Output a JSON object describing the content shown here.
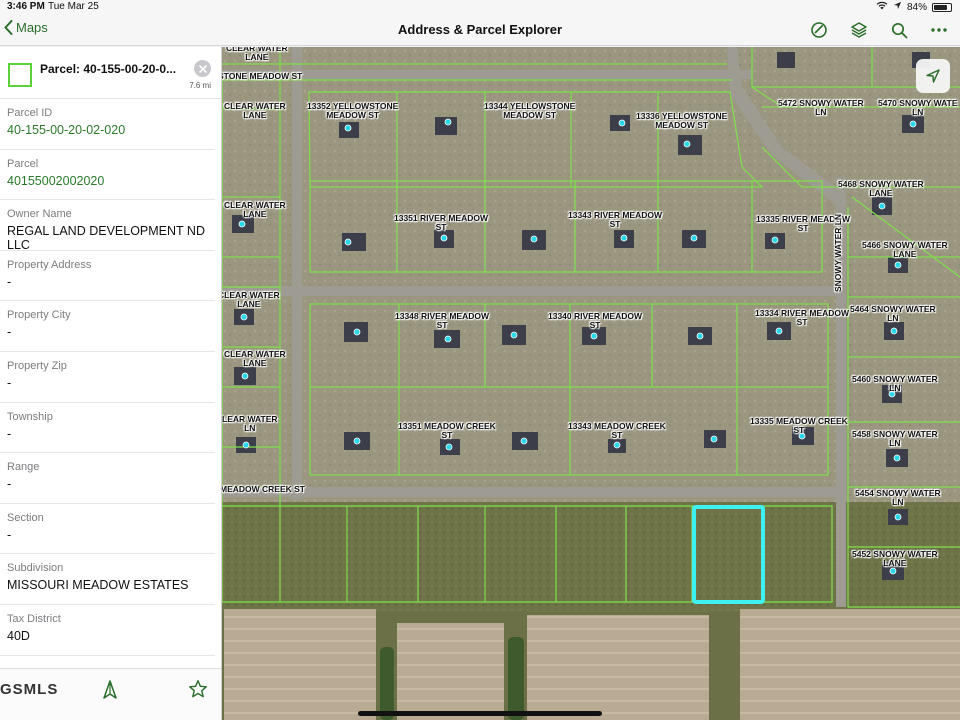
{
  "status": {
    "time": "3:46 PM",
    "date": "Tue Mar 25",
    "battery": "84%",
    "battery_level": 0.84
  },
  "nav": {
    "back_label": "Maps",
    "title": "Address & Parcel Explorer",
    "actions": [
      "measure-icon",
      "layers-icon",
      "search-icon",
      "more-icon"
    ]
  },
  "parcel": {
    "title": "Parcel: 40-155-00-20-0...",
    "distance": "7.6 mi",
    "fields": [
      {
        "label": "Parcel ID",
        "value": "40-155-00-20-02-020",
        "link": true
      },
      {
        "label": "Parcel",
        "value": "40155002002020",
        "link": true
      },
      {
        "label": "Owner Name",
        "value": "REGAL LAND DEVELOPMENT ND LLC",
        "link": false
      },
      {
        "label": "Property Address",
        "value": "-",
        "link": false
      },
      {
        "label": "Property City",
        "value": "-",
        "link": false
      },
      {
        "label": "Property Zip",
        "value": "-",
        "link": false
      },
      {
        "label": "Township",
        "value": "-",
        "link": false
      },
      {
        "label": "Range",
        "value": "-",
        "link": false
      },
      {
        "label": "Section",
        "value": "-",
        "link": false
      },
      {
        "label": "Subdivision",
        "value": "MISSOURI MEADOW ESTATES",
        "link": false
      },
      {
        "label": "Tax District",
        "value": "40D",
        "link": false
      }
    ]
  },
  "tabbar": {
    "logo": "GSMLS",
    "icons": [
      "compass-icon",
      "star-icon"
    ]
  },
  "map": {
    "labels": [
      {
        "text": "CLEAR WATER\nLANE"
      },
      {
        "text": "STONE MEADOW ST"
      },
      {
        "text": "CLEAR WATER\nLANE"
      },
      {
        "text": "13352 YELLOWSTONE\nMEADOW ST"
      },
      {
        "text": "13344 YELLOWSTONE\nMEADOW ST"
      },
      {
        "text": "13336 YELLOWSTONE\nMEADOW ST"
      },
      {
        "text": "5472 SNOWY WATER\nLN"
      },
      {
        "text": "5470 SNOWY WATE\nLN"
      },
      {
        "text": "5468 SNOWY WATER\nLANE"
      },
      {
        "text": "CLEAR WATER\nLANE"
      },
      {
        "text": "13351 RIVER MEADOW\nST"
      },
      {
        "text": "13343 RIVER MEADOW\nST"
      },
      {
        "text": "13335 RIVER MEADOW\nST"
      },
      {
        "text": "SNOWY WATER LN"
      },
      {
        "text": "5466 SNOWY WATER\nLANE"
      },
      {
        "text": "CLEAR WATER\nLANE"
      },
      {
        "text": "13348 RIVER MEADOW\nST"
      },
      {
        "text": "13340 RIVER MEADOW\nST"
      },
      {
        "text": "13334 RIVER MEADOW\nST"
      },
      {
        "text": "5464 SNOWY WATER\nLN"
      },
      {
        "text": "CLEAR WATER\nLANE"
      },
      {
        "text": "5460 SNOWY WATER\nLN"
      },
      {
        "text": "LEAR WATER\nLN"
      },
      {
        "text": "13351 MEADOW CREEK\nST"
      },
      {
        "text": "13343 MEADOW CREEK\nST"
      },
      {
        "text": "13335 MEADOW CREEK\nST"
      },
      {
        "text": "5458 SNOWY WATER\nLN"
      },
      {
        "text": "MEADOW CREEK ST"
      },
      {
        "text": "5454 SNOWY WATER\nLN"
      },
      {
        "text": "5452 SNOWY WATER\nLANE"
      }
    ]
  },
  "colors": {
    "accent": "#2a7a2a",
    "parcel_line": "#7ee04a",
    "selected": "#3ff0f0",
    "marker": "#29d7e8"
  }
}
